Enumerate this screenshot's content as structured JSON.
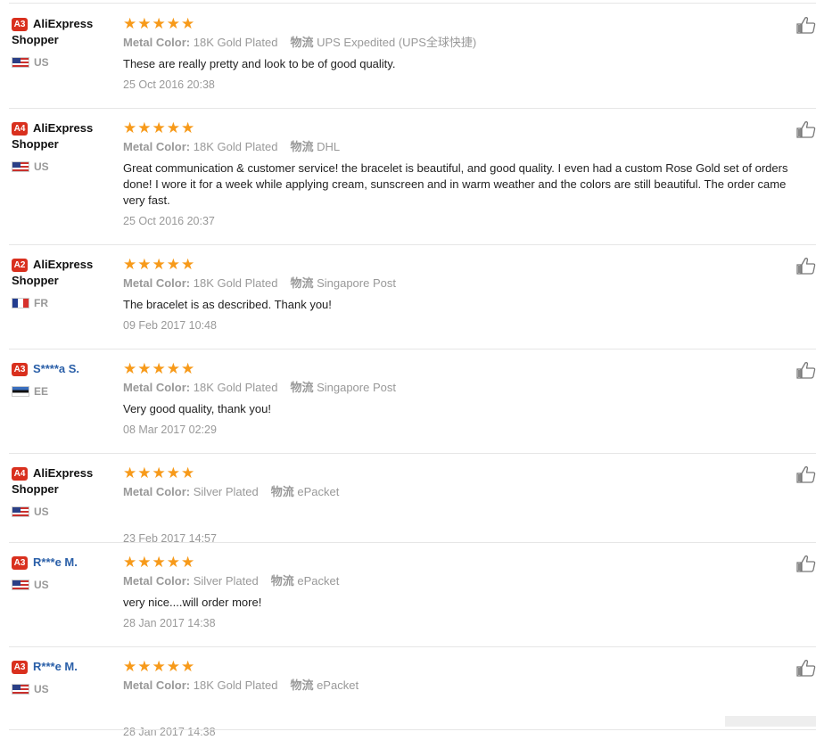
{
  "reviews": [
    {
      "badge": "A3",
      "name_line1": "AliExpress",
      "name_line2": "Shopper",
      "name_link": false,
      "flag": "us",
      "country": "US",
      "metal_label": "Metal Color:",
      "metal": "18K Gold Plated",
      "ship_label": "物流",
      "shipping": "UPS Expedited (UPS全球快捷)",
      "text": [
        "These are really pretty and look to be of good quality."
      ],
      "date": "25 Oct 2016 20:38",
      "rating": 5
    },
    {
      "badge": "A4",
      "name_line1": "AliExpress",
      "name_line2": "Shopper",
      "name_link": false,
      "flag": "us",
      "country": "US",
      "metal_label": "Metal Color:",
      "metal": "18K Gold Plated",
      "ship_label": "物流",
      "shipping": "DHL",
      "text": [
        "Great communication & customer service! the bracelet is beautiful, and good quality. I even had a custom Rose Gold set of orders",
        "done! I wore it for a week while applying cream, sunscreen and in warm weather and the colors are still beautiful. The order came",
        "very fast."
      ],
      "date": "25 Oct 2016 20:37",
      "rating": 5
    },
    {
      "badge": "A2",
      "name_line1": "AliExpress",
      "name_line2": "Shopper",
      "name_link": false,
      "flag": "fr",
      "country": "FR",
      "metal_label": "Metal Color:",
      "metal": "18K Gold Plated",
      "ship_label": "物流",
      "shipping": "Singapore Post",
      "text": [
        "The bracelet is as described. Thank you!"
      ],
      "date": "09 Feb 2017 10:48",
      "rating": 5
    },
    {
      "badge": "A3",
      "name_line1": "S****a S.",
      "name_line2": "",
      "name_link": true,
      "flag": "ee",
      "country": "EE",
      "metal_label": "Metal Color:",
      "metal": "18K Gold Plated",
      "ship_label": "物流",
      "shipping": "Singapore Post",
      "text": [
        "Very good quality, thank you!"
      ],
      "date": "08 Mar 2017 02:29",
      "rating": 5
    },
    {
      "badge": "A4",
      "name_line1": "AliExpress",
      "name_line2": "Shopper",
      "name_link": false,
      "flag": "us",
      "country": "US",
      "metal_label": "Metal Color:",
      "metal": "Silver Plated",
      "ship_label": "物流",
      "shipping": "ePacket",
      "text": [],
      "date": "23 Feb 2017 14:57",
      "rating": 5
    },
    {
      "badge": "A3",
      "name_line1": "R***e M.",
      "name_line2": "",
      "name_link": true,
      "flag": "us",
      "country": "US",
      "metal_label": "Metal Color:",
      "metal": "Silver Plated",
      "ship_label": "物流",
      "shipping": "ePacket",
      "text": [
        "very nice....will order more!"
      ],
      "date": "28 Jan 2017 14:38",
      "rating": 5
    },
    {
      "badge": "A3",
      "name_line1": "R***e M.",
      "name_line2": "",
      "name_link": true,
      "flag": "us",
      "country": "US",
      "metal_label": "Metal Color:",
      "metal": "18K Gold Plated",
      "ship_label": "物流",
      "shipping": "ePacket",
      "text": [],
      "date": "28 Jan 2017 14:38",
      "rating": 5
    }
  ]
}
